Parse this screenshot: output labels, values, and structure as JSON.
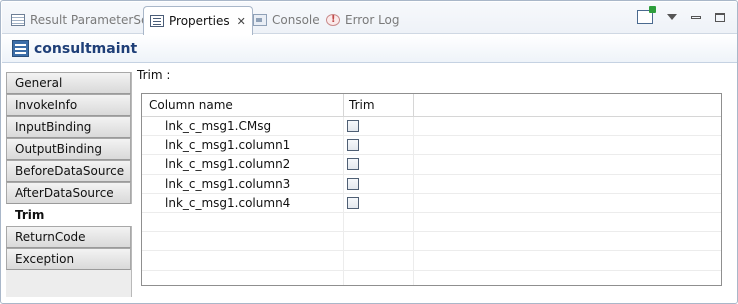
{
  "tabs": [
    {
      "label": "Result ParameterSet",
      "icon": "table-icon",
      "active": false
    },
    {
      "label": "Properties",
      "icon": "properties-icon",
      "active": true
    },
    {
      "label": "Console",
      "icon": "console-icon",
      "active": false
    },
    {
      "label": "Error Log",
      "icon": "error-log-icon",
      "active": false
    }
  ],
  "title": "consultmaint",
  "nav": [
    {
      "label": "General"
    },
    {
      "label": "InvokeInfo"
    },
    {
      "label": "InputBinding"
    },
    {
      "label": "OutputBinding"
    },
    {
      "label": "BeforeDataSource"
    },
    {
      "label": "AfterDataSource"
    },
    {
      "label": "Trim"
    },
    {
      "label": "ReturnCode"
    },
    {
      "label": "Exception"
    }
  ],
  "active_nav": "Trim",
  "section_label": "Trim :",
  "table": {
    "columns": [
      "Column name",
      "Trim",
      ""
    ],
    "rows": [
      {
        "name": "lnk_c_msg1.CMsg",
        "trim": false
      },
      {
        "name": "lnk_c_msg1.column1",
        "trim": false
      },
      {
        "name": "lnk_c_msg1.column2",
        "trim": false
      },
      {
        "name": "lnk_c_msg1.column3",
        "trim": false
      },
      {
        "name": "lnk_c_msg1.column4",
        "trim": false
      },
      {
        "name": "",
        "trim": null
      },
      {
        "name": "",
        "trim": null
      },
      {
        "name": "",
        "trim": null
      },
      {
        "name": "",
        "trim": null
      }
    ]
  }
}
